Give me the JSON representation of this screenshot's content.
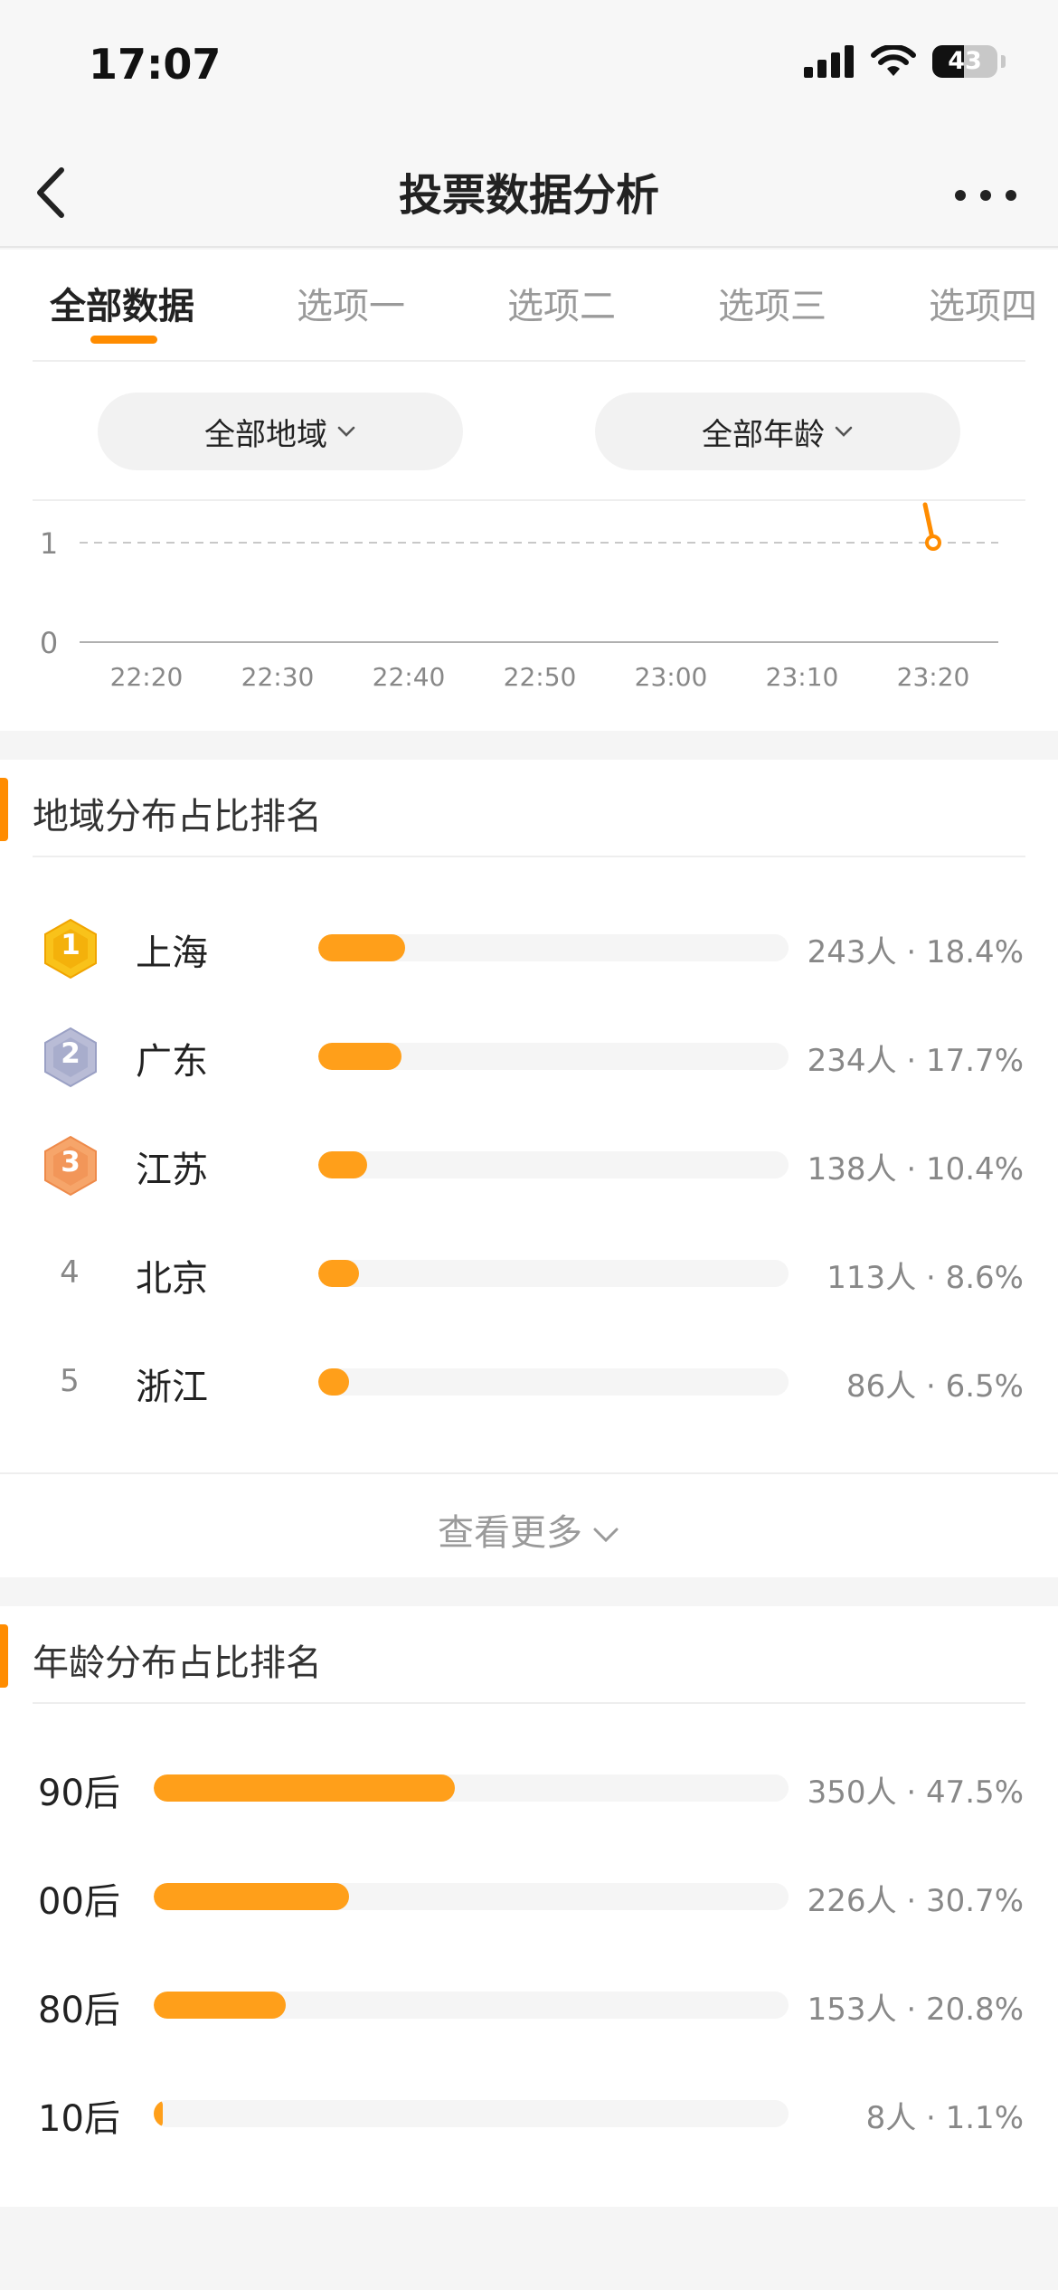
{
  "status_bar": {
    "time": "17:07",
    "battery": "43"
  },
  "nav": {
    "title": "投票数据分析"
  },
  "tabs": [
    {
      "label": "全部数据",
      "active": true
    },
    {
      "label": "选项一",
      "active": false
    },
    {
      "label": "选项二",
      "active": false
    },
    {
      "label": "选项三",
      "active": false
    },
    {
      "label": "选项四",
      "active": false
    }
  ],
  "filters": {
    "region": "全部地域",
    "age": "全部年龄"
  },
  "colors": {
    "accent": "#ff8c00",
    "bar": "#ff9f1a",
    "gold": "#f9c21a",
    "silver": "#b9bcd6",
    "bronze": "#f6a56a"
  },
  "chart_data": {
    "type": "line",
    "x": [
      "22:20",
      "22:30",
      "22:40",
      "22:50",
      "23:00",
      "23:10",
      "23:20"
    ],
    "y_ticks": [
      0,
      1
    ],
    "ylim": [
      0,
      1
    ],
    "series": [
      {
        "points": [
          {
            "x": "23:20",
            "y": 1
          }
        ]
      }
    ],
    "grid": "dashed at 1"
  },
  "region_section": {
    "title": "地域分布占比排名",
    "rows": [
      {
        "rank": "1",
        "label": "上海",
        "value": "243人 · 18.4%",
        "percent": 18.4
      },
      {
        "rank": "2",
        "label": "广东",
        "value": "234人 · 17.7%",
        "percent": 17.7
      },
      {
        "rank": "3",
        "label": "江苏",
        "value": "138人 · 10.4%",
        "percent": 10.4
      },
      {
        "rank": "4",
        "label": "北京",
        "value": "113人 · 8.6%",
        "percent": 8.6
      },
      {
        "rank": "5",
        "label": "浙江",
        "value": "86人 · 6.5%",
        "percent": 6.5
      }
    ],
    "more": "查看更多"
  },
  "age_section": {
    "title": "年龄分布占比排名",
    "rows": [
      {
        "label": "90后",
        "value": "350人 · 47.5%",
        "percent": 47.5
      },
      {
        "label": "00后",
        "value": "226人 · 30.7%",
        "percent": 30.7
      },
      {
        "label": "80后",
        "value": "153人 · 20.8%",
        "percent": 20.8
      },
      {
        "label": "10后",
        "value": "8人 · 1.1%",
        "percent": 1.1
      }
    ]
  }
}
